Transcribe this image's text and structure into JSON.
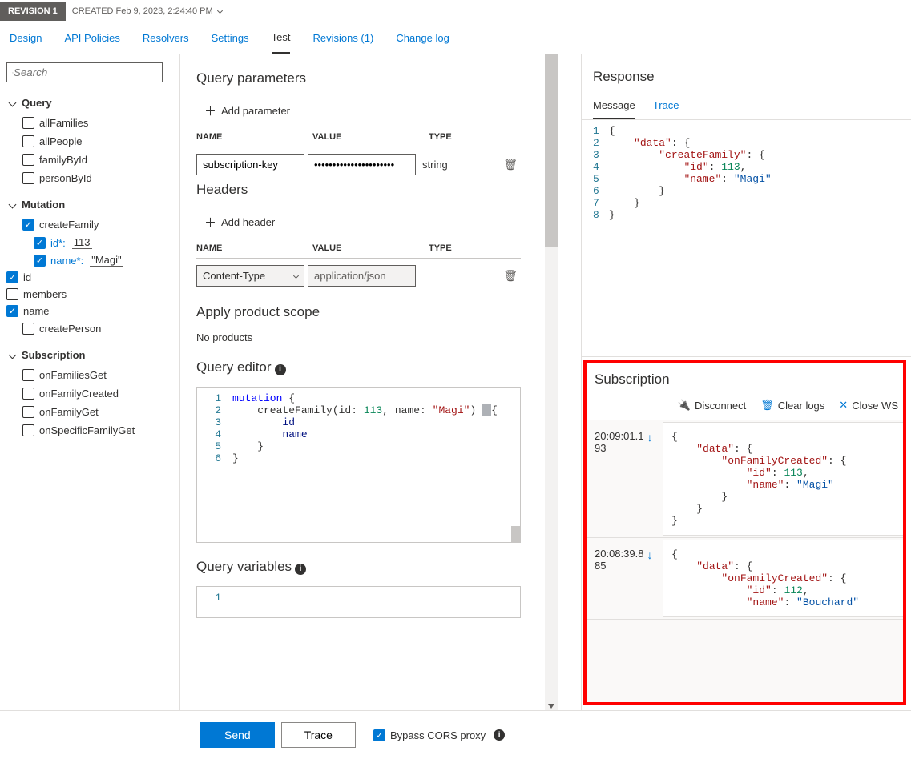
{
  "topbar": {
    "revision_badge": "REVISION 1",
    "created": "CREATED Feb 9, 2023, 2:24:40 PM"
  },
  "tabs": [
    "Design",
    "API Policies",
    "Resolvers",
    "Settings",
    "Test",
    "Revisions (1)",
    "Change log"
  ],
  "active_tab_index": 4,
  "sidebar": {
    "search_placeholder": "Search",
    "sections": {
      "query": {
        "title": "Query",
        "items": [
          {
            "label": "allFamilies",
            "checked": false
          },
          {
            "label": "allPeople",
            "checked": false
          },
          {
            "label": "familyById",
            "checked": false
          },
          {
            "label": "personById",
            "checked": false
          }
        ]
      },
      "mutation": {
        "title": "Mutation",
        "items": [
          {
            "label": "createFamily",
            "checked": true,
            "params": [
              {
                "name": "id*:",
                "value": "113",
                "checked": true
              },
              {
                "name": "name*:",
                "value": "\"Magi\"",
                "checked": true
              }
            ],
            "fields": [
              {
                "label": "id",
                "checked": true
              },
              {
                "label": "members",
                "checked": false
              },
              {
                "label": "name",
                "checked": true
              }
            ]
          },
          {
            "label": "createPerson",
            "checked": false
          }
        ]
      },
      "subscription": {
        "title": "Subscription",
        "items": [
          {
            "label": "onFamiliesGet",
            "checked": false
          },
          {
            "label": "onFamilyCreated",
            "checked": false
          },
          {
            "label": "onFamilyGet",
            "checked": false
          },
          {
            "label": "onSpecificFamilyGet",
            "checked": false
          }
        ]
      }
    }
  },
  "center": {
    "query_params": {
      "title": "Query parameters",
      "add_label": "Add parameter",
      "headers": {
        "name": "NAME",
        "value": "VALUE",
        "type": "TYPE"
      },
      "rows": [
        {
          "name": "subscription-key",
          "value": "••••••••••••••••••••••",
          "type": "string"
        }
      ]
    },
    "headers_section": {
      "title": "Headers",
      "add_label": "Add header",
      "headers": {
        "name": "NAME",
        "value": "VALUE",
        "type": "TYPE"
      },
      "rows": [
        {
          "name": "Content-Type",
          "value": "application/json",
          "type": ""
        }
      ]
    },
    "scope": {
      "title": "Apply product scope",
      "no_products": "No products"
    },
    "query_editor": {
      "title": "Query editor",
      "lines": [
        "mutation {",
        "    createFamily(id: 113, name: \"Magi\") {",
        "        id",
        "        name",
        "    }",
        "}"
      ]
    },
    "query_variables": {
      "title": "Query variables",
      "lines": [
        ""
      ]
    }
  },
  "response": {
    "title": "Response",
    "tabs": [
      "Message",
      "Trace"
    ],
    "active_tab": 0,
    "json_lines": [
      "{",
      "    \"data\": {",
      "        \"createFamily\": {",
      "            \"id\": 113,",
      "            \"name\": \"Magi\"",
      "        }",
      "    }",
      "}"
    ]
  },
  "subscription_panel": {
    "title": "Subscription",
    "actions": {
      "disconnect": "Disconnect",
      "clear": "Clear logs",
      "close": "Close WS"
    },
    "logs": [
      {
        "ts_line1": "20:09:01.1",
        "ts_line2": "93",
        "json_lines": [
          "{",
          "    \"data\": {",
          "        \"onFamilyCreated\": {",
          "            \"id\": 113,",
          "            \"name\": \"Magi\"",
          "        }",
          "    }",
          "}"
        ]
      },
      {
        "ts_line1": "20:08:39.8",
        "ts_line2": "85",
        "json_lines": [
          "{",
          "    \"data\": {",
          "        \"onFamilyCreated\": {",
          "            \"id\": 112,",
          "            \"name\": \"Bouchard\""
        ]
      }
    ]
  },
  "footer": {
    "send": "Send",
    "trace": "Trace",
    "bypass": "Bypass CORS proxy"
  }
}
